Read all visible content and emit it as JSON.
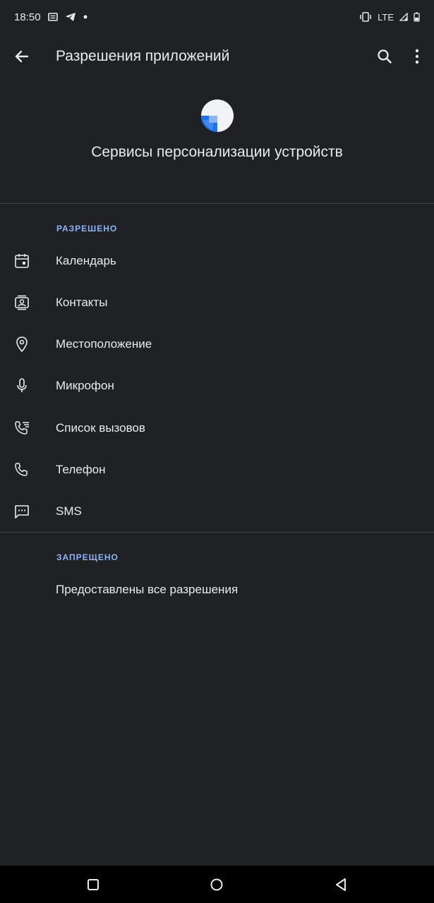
{
  "status_bar": {
    "time": "18:50",
    "network": "LTE",
    "left_icons": [
      "message-icon",
      "telegram-icon",
      "dot-icon"
    ],
    "right_icons": [
      "vibrate-icon",
      "signal-icon",
      "battery-icon"
    ]
  },
  "app_bar": {
    "title": "Разрешения приложений",
    "back_icon": "arrow-back-icon",
    "search_icon": "search-icon",
    "more_icon": "more-vert-icon"
  },
  "app": {
    "name": "Сервисы персонализации устройств",
    "icon": "app-icon"
  },
  "allowed": {
    "header": "РАЗРЕШЕНО",
    "items": [
      {
        "label": "Календарь",
        "icon": "calendar-icon"
      },
      {
        "label": "Контакты",
        "icon": "contacts-icon"
      },
      {
        "label": "Местоположение",
        "icon": "location-icon"
      },
      {
        "label": "Микрофон",
        "icon": "microphone-icon"
      },
      {
        "label": "Список вызовов",
        "icon": "call-log-icon"
      },
      {
        "label": "Телефон",
        "icon": "phone-icon"
      },
      {
        "label": "SMS",
        "icon": "sms-icon"
      }
    ]
  },
  "denied": {
    "header": "ЗАПРЕЩЕНО",
    "text": "Предоставлены все разрешения"
  },
  "nav_bar": {
    "buttons": [
      "recents-icon",
      "home-icon",
      "back-triangle-icon"
    ]
  },
  "colors": {
    "background": "#202125",
    "accent": "#8ab4f8",
    "text": "#e8eaed",
    "divider": "#3c4043"
  }
}
